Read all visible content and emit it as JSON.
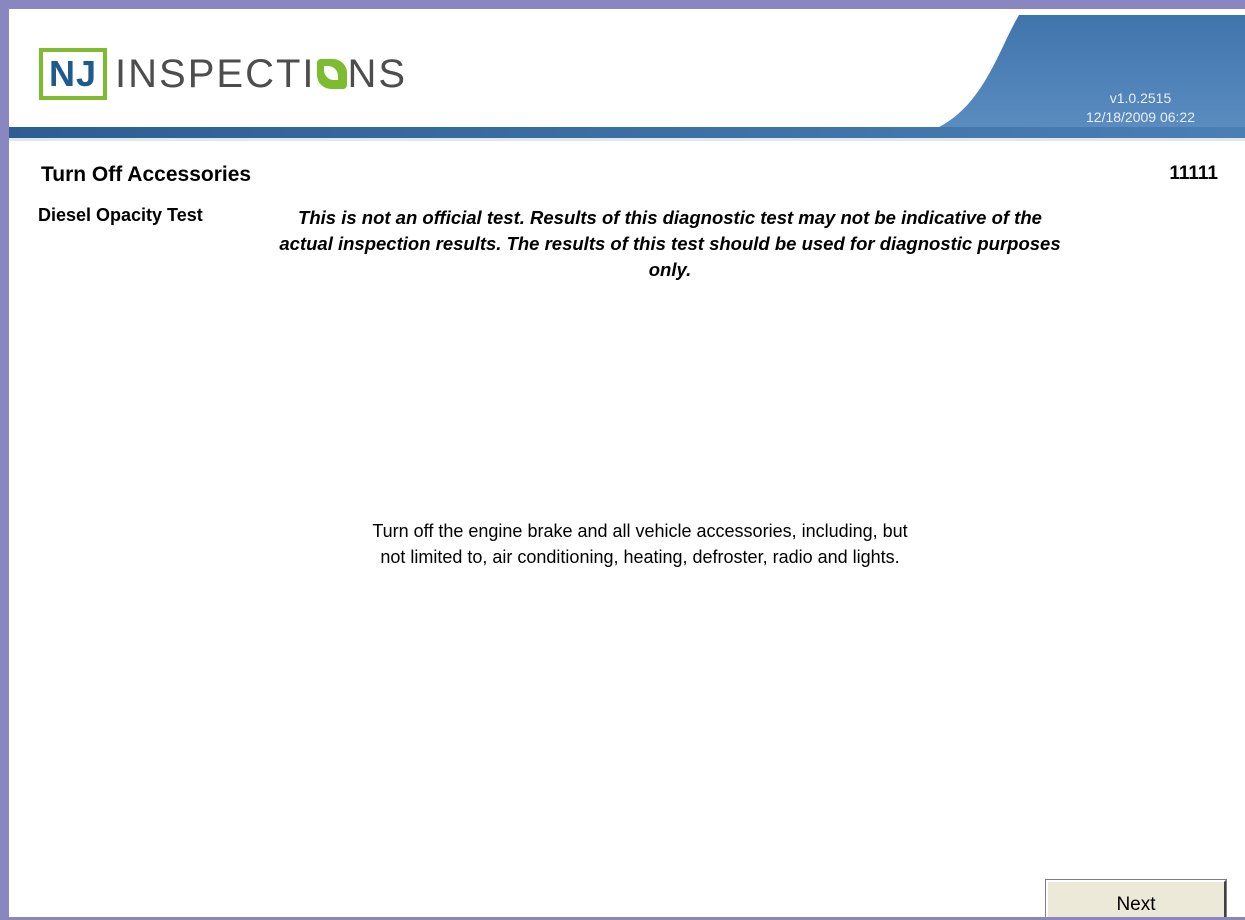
{
  "header": {
    "logo": {
      "boxed": "NJ",
      "text_before": "INSPECTI",
      "text_after": "NS"
    },
    "version": "v1.0.2515",
    "datetime": "12/18/2009 06:22"
  },
  "screen": {
    "title": "Turn Off Accessories",
    "code": "11111",
    "test_name": "Diesel Opacity Test",
    "disclaimer": "This is not an official test. Results of this diagnostic test may not be indicative of the actual inspection results. The results of this test should be used for diagnostic purposes only.",
    "instructions_line1": "Turn off the engine brake and all vehicle accessories, including, but",
    "instructions_line2": "not limited to, air conditioning, heating, defroster, radio and lights."
  },
  "buttons": {
    "next_label": "Next"
  },
  "colors": {
    "header_blue": "#4a7fb5",
    "logo_green": "#7cbc2e",
    "logo_navy": "#1f5a8e",
    "frame_purple": "#8a86c0"
  }
}
